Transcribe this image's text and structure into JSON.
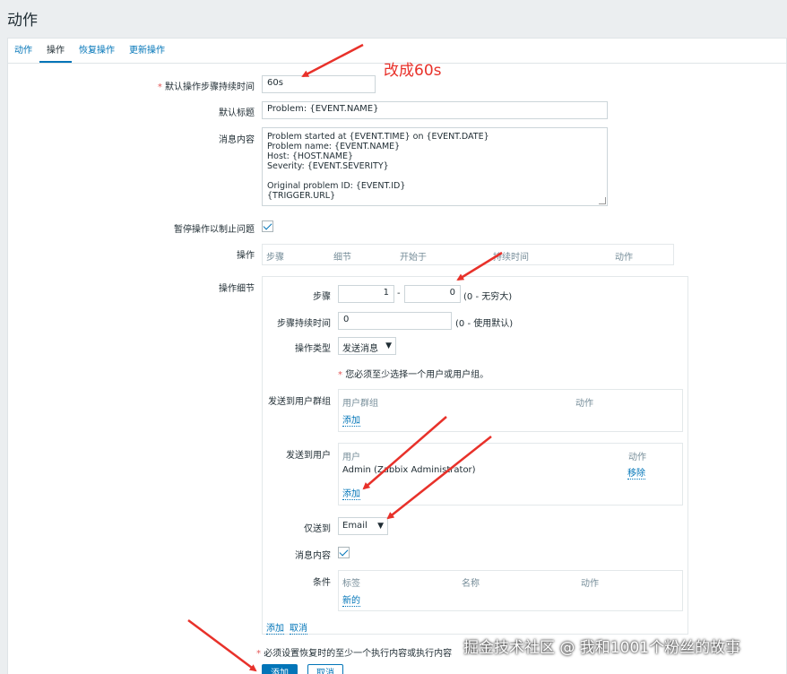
{
  "page_title": "动作",
  "tabs": [
    {
      "label": "动作",
      "active": false
    },
    {
      "label": "操作",
      "active": true
    },
    {
      "label": "恢复操作",
      "active": false
    },
    {
      "label": "更新操作",
      "active": false
    }
  ],
  "annotation": "改成60s",
  "form": {
    "default_step_duration": {
      "label": "默认操作步骤持续时间",
      "value": "60s"
    },
    "default_subject": {
      "label": "默认标题",
      "value": "Problem: {EVENT.NAME}"
    },
    "default_message": {
      "label": "消息内容",
      "value": "Problem started at {EVENT.TIME} on {EVENT.DATE}\nProblem name: {EVENT.NAME}\nHost: {HOST.NAME}\nSeverity: {EVENT.SEVERITY}\n\nOriginal problem ID: {EVENT.ID}\n{TRIGGER.URL}"
    },
    "pause_suppressed": {
      "label": "暂停操作以制止问题",
      "checked": true
    },
    "operations": {
      "label": "操作",
      "columns": [
        "步骤",
        "细节",
        "开始于",
        "持续时间",
        "动作"
      ]
    },
    "operation_details": {
      "label": "操作细节",
      "steps": {
        "label": "步骤",
        "from": "1",
        "separator": "-",
        "to": "0",
        "hint": "(0 - 无穷大)"
      },
      "step_duration": {
        "label": "步骤持续时间",
        "value": "0",
        "hint": "(0 - 使用默认)"
      },
      "operation_type": {
        "label": "操作类型",
        "value": "发送消息"
      },
      "required_note": "您必须至少选择一个用户或用户组。",
      "user_groups": {
        "label": "发送到用户群组",
        "columns": [
          "用户群组",
          "动作"
        ],
        "add_label": "添加"
      },
      "users": {
        "label": "发送到用户",
        "columns": [
          "用户",
          "动作"
        ],
        "rows": [
          {
            "name": "Admin (Zabbix Administrator)",
            "action": "移除"
          }
        ],
        "add_label": "添加"
      },
      "send_only_to": {
        "label": "仅送到",
        "value": "Email"
      },
      "default_message": {
        "label": "消息内容",
        "checked": true
      },
      "conditions": {
        "label": "条件",
        "columns": [
          "标签",
          "名称",
          "动作"
        ],
        "new_label": "新的"
      },
      "add_link": "添加",
      "cancel_link": "取消"
    }
  },
  "footer_note": "必须设置恢复时的至少一个执行内容或执行内容",
  "buttons": {
    "add": "添加",
    "cancel": "取消"
  },
  "watermark": "掘金技术社区 @ 我和1001个粉丝的故事",
  "colors": {
    "accent": "#0275b8",
    "annotation": "#e8312a",
    "background": "#ebeef0"
  }
}
